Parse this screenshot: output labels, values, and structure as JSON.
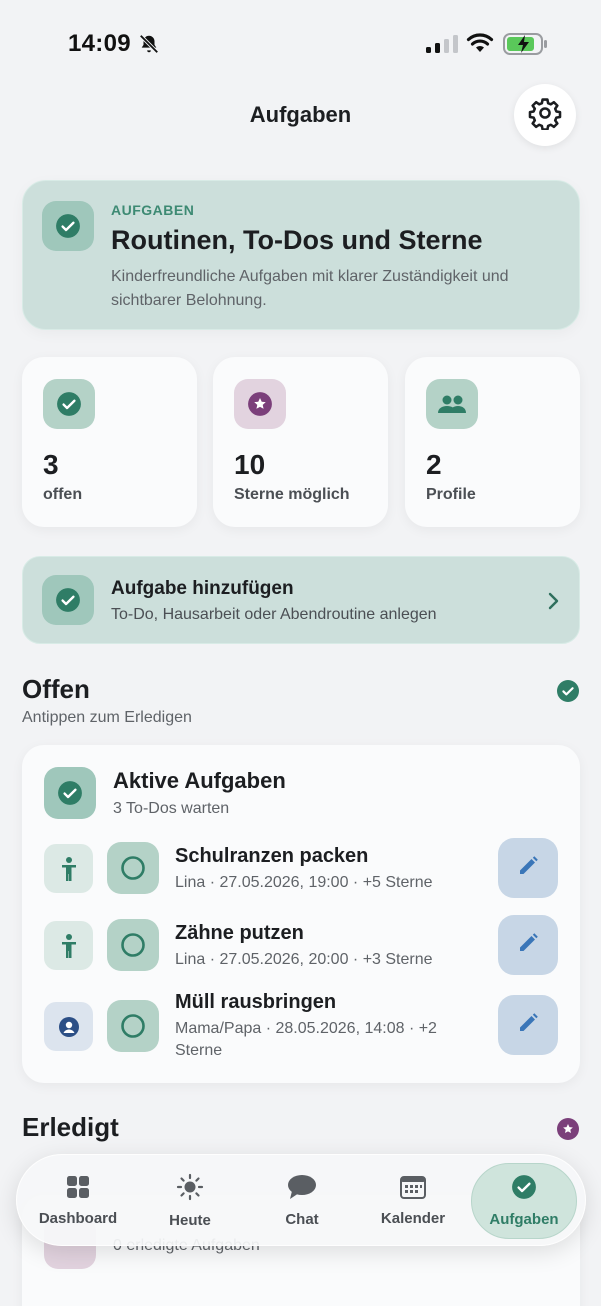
{
  "status_bar": {
    "time": "14:09"
  },
  "header": {
    "title": "Aufgaben"
  },
  "hero": {
    "eyebrow": "AUFGABEN",
    "title": "Routinen, To-Dos und Sterne",
    "subtitle": "Kinderfreundliche Aufgaben mit klarer Zuständigkeit und sichtbarer Belohnung."
  },
  "stats": [
    {
      "value": "3",
      "label": "offen",
      "icon": "check-circle-icon"
    },
    {
      "value": "10",
      "label": "Sterne möglich",
      "icon": "star-icon"
    },
    {
      "value": "2",
      "label": "Profile",
      "icon": "people-icon"
    }
  ],
  "add_task": {
    "title": "Aufgabe hinzufügen",
    "subtitle": "To-Do, Hausarbeit oder Abendroutine anlegen"
  },
  "open_section": {
    "title": "Offen",
    "subtitle": "Antippen zum Erledigen"
  },
  "active_tasks": {
    "title": "Aktive Aufgaben",
    "subtitle": "3 To-Dos warten",
    "tasks": [
      {
        "name": "Schulranzen packen",
        "meta": "Lina · 27.05.2026, 19:00 · +5 Sterne",
        "assignee_icon": "child-icon"
      },
      {
        "name": "Zähne putzen",
        "meta": "Lina · 27.05.2026, 20:00 · +3 Sterne",
        "assignee_icon": "child-icon"
      },
      {
        "name": "Müll rausbringen",
        "meta": "Mama/Papa · 28.05.2026, 14:08 · +2 Sterne",
        "assignee_icon": "parent-icon"
      }
    ]
  },
  "done_section": {
    "title": "Erledigt",
    "card_subtitle": "0 erledigte Aufgaben"
  },
  "tabs": [
    {
      "label": "Dashboard",
      "icon": "grid-icon"
    },
    {
      "label": "Heute",
      "icon": "sun-icon"
    },
    {
      "label": "Chat",
      "icon": "chat-icon"
    },
    {
      "label": "Kalender",
      "icon": "calendar-icon"
    },
    {
      "label": "Aufgaben",
      "icon": "check-circle-icon",
      "active": true
    }
  ],
  "colors": {
    "accent_green": "#3d8a73",
    "card_green": "#ccdfdb",
    "star_purple": "#7b3f7a",
    "edit_blue": "#3a76b8"
  }
}
